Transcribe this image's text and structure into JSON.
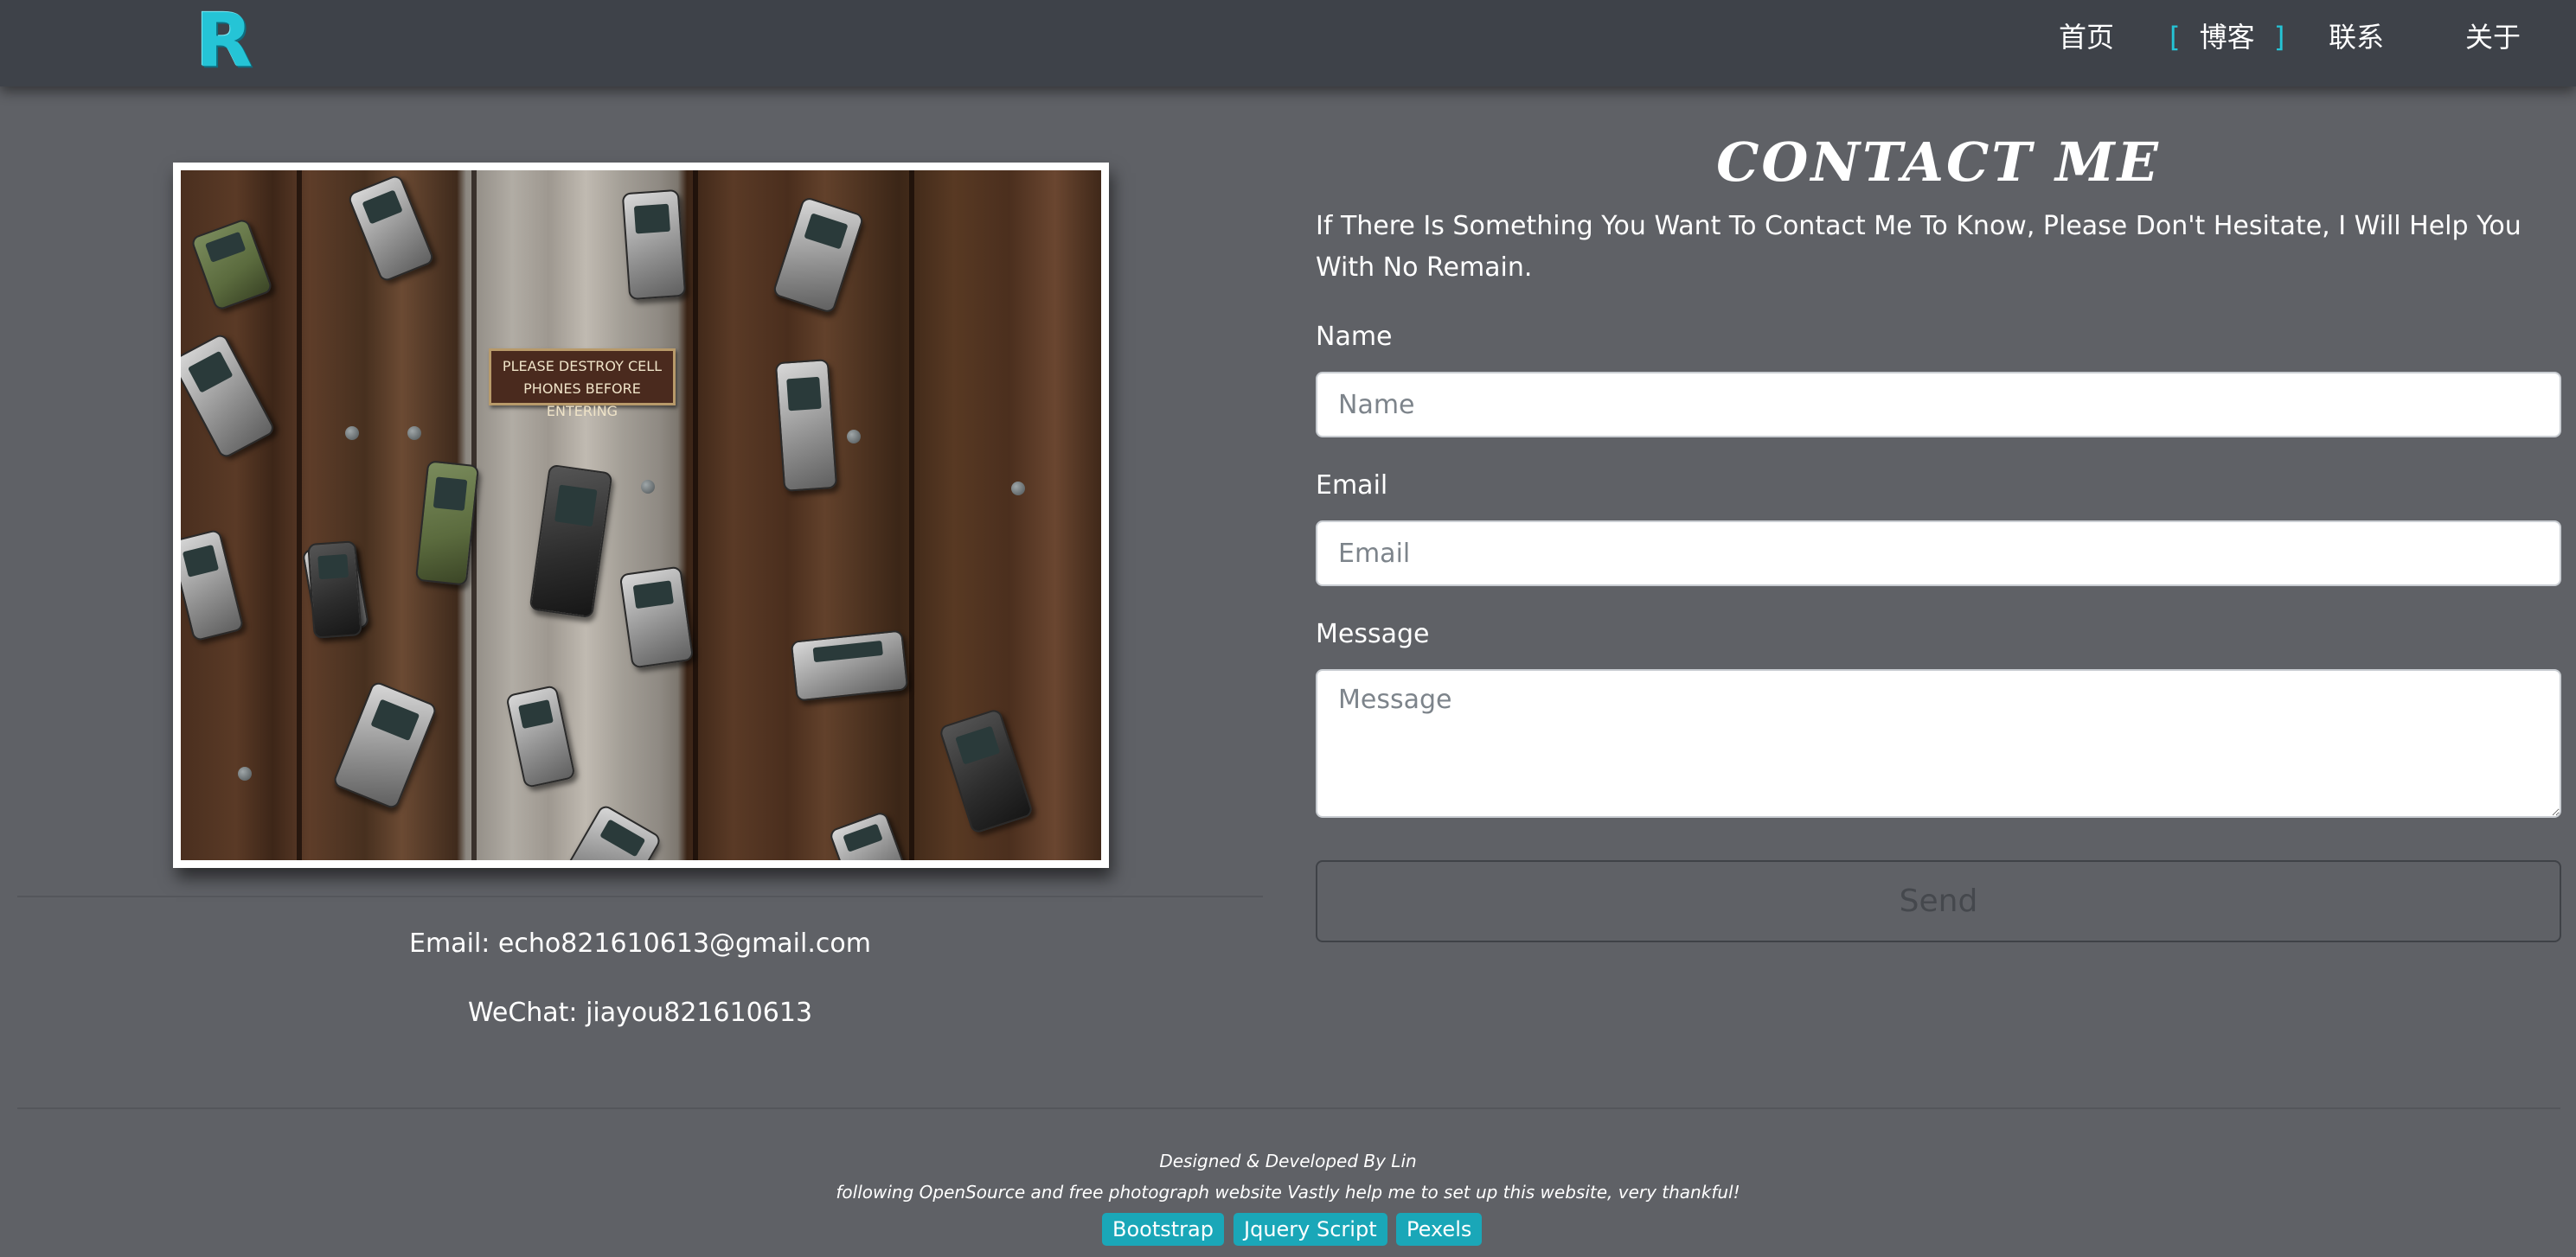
{
  "navbar": {
    "logo": "R",
    "items": [
      {
        "label": "首页",
        "active": false
      },
      {
        "label": "博客",
        "active": true,
        "bracket_left": "[",
        "bracket_right": "]"
      },
      {
        "label": "联系",
        "active": false
      },
      {
        "label": "关于",
        "active": false
      }
    ]
  },
  "photo": {
    "sign_line1": "PLEASE DESTROY CELL",
    "sign_line2": "PHONES BEFORE ENTERING"
  },
  "contact_info": {
    "email": "Email: echo821610613@gmail.com",
    "wechat": "WeChat: jiayou821610613"
  },
  "form": {
    "title": "CONTACT ME",
    "intro": "If There Is Something You Want To Contact Me To Know, Please Don't Hesitate, I Will Help You With No Remain.",
    "name_label": "Name",
    "name_placeholder": "Name",
    "email_label": "Email",
    "email_placeholder": "Email",
    "message_label": "Message",
    "message_placeholder": "Message",
    "send_label": "Send"
  },
  "footer": {
    "credit": "Designed & Developed By Lin",
    "thanks": "following OpenSource and free photograph website Vastly help me to set up this website, very thankful!",
    "badges": [
      "Bootstrap",
      "Jquery Script",
      "Pexels"
    ]
  },
  "colors": {
    "accent": "#25c4d6",
    "navbar_bg": "#3e4249",
    "page_bg": "#5f6166",
    "badge_bg": "#1aa7b8"
  }
}
